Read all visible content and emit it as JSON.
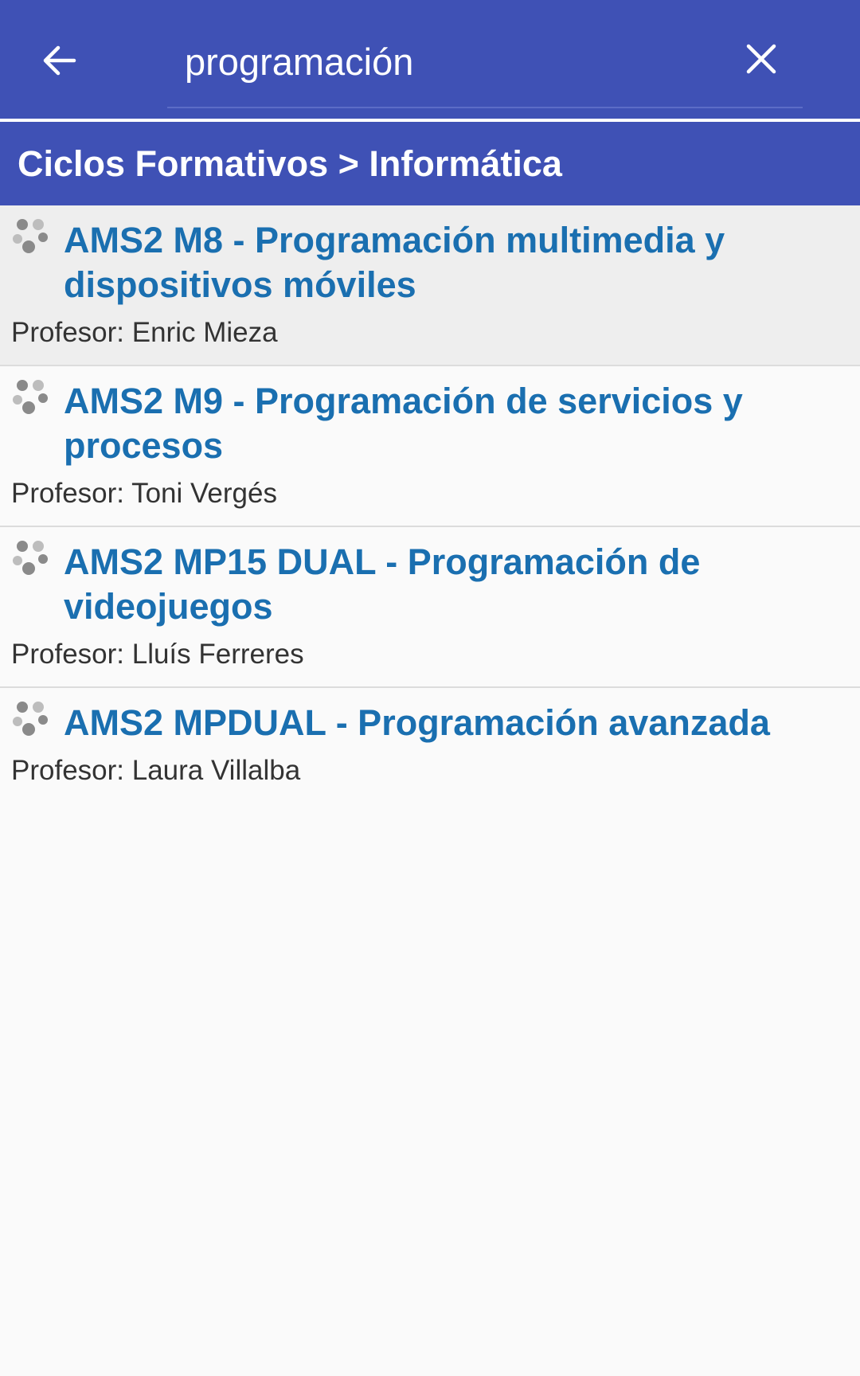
{
  "app_bar": {
    "back_icon": "arrow-left-icon",
    "search": {
      "value": "programación",
      "placeholder": ""
    },
    "clear_icon": "close-icon",
    "background_color": "#3f51b5"
  },
  "category": {
    "path": "Ciclos Formativos > Informática"
  },
  "results": [
    {
      "title": "AMS2 M8 - Programación multimedia y dispositivos móviles",
      "teacher": "Profesor: Enric Mieza",
      "icon": "course-icon"
    },
    {
      "title": "AMS2 M9 - Programación de servicios y procesos",
      "teacher": "Profesor: Toni Vergés",
      "icon": "course-icon"
    },
    {
      "title": "AMS2 MP15 DUAL - Programación de videojuegos",
      "teacher": "Profesor: Lluís Ferreres",
      "icon": "course-icon"
    },
    {
      "title": "AMS2 MPDUAL - Programación avanzada",
      "teacher": "Profesor: Laura Villalba",
      "icon": "course-icon"
    }
  ],
  "colors": {
    "accent": "#3f51b5",
    "link": "#1a6fb0",
    "selected_row": "#eeeeee"
  }
}
